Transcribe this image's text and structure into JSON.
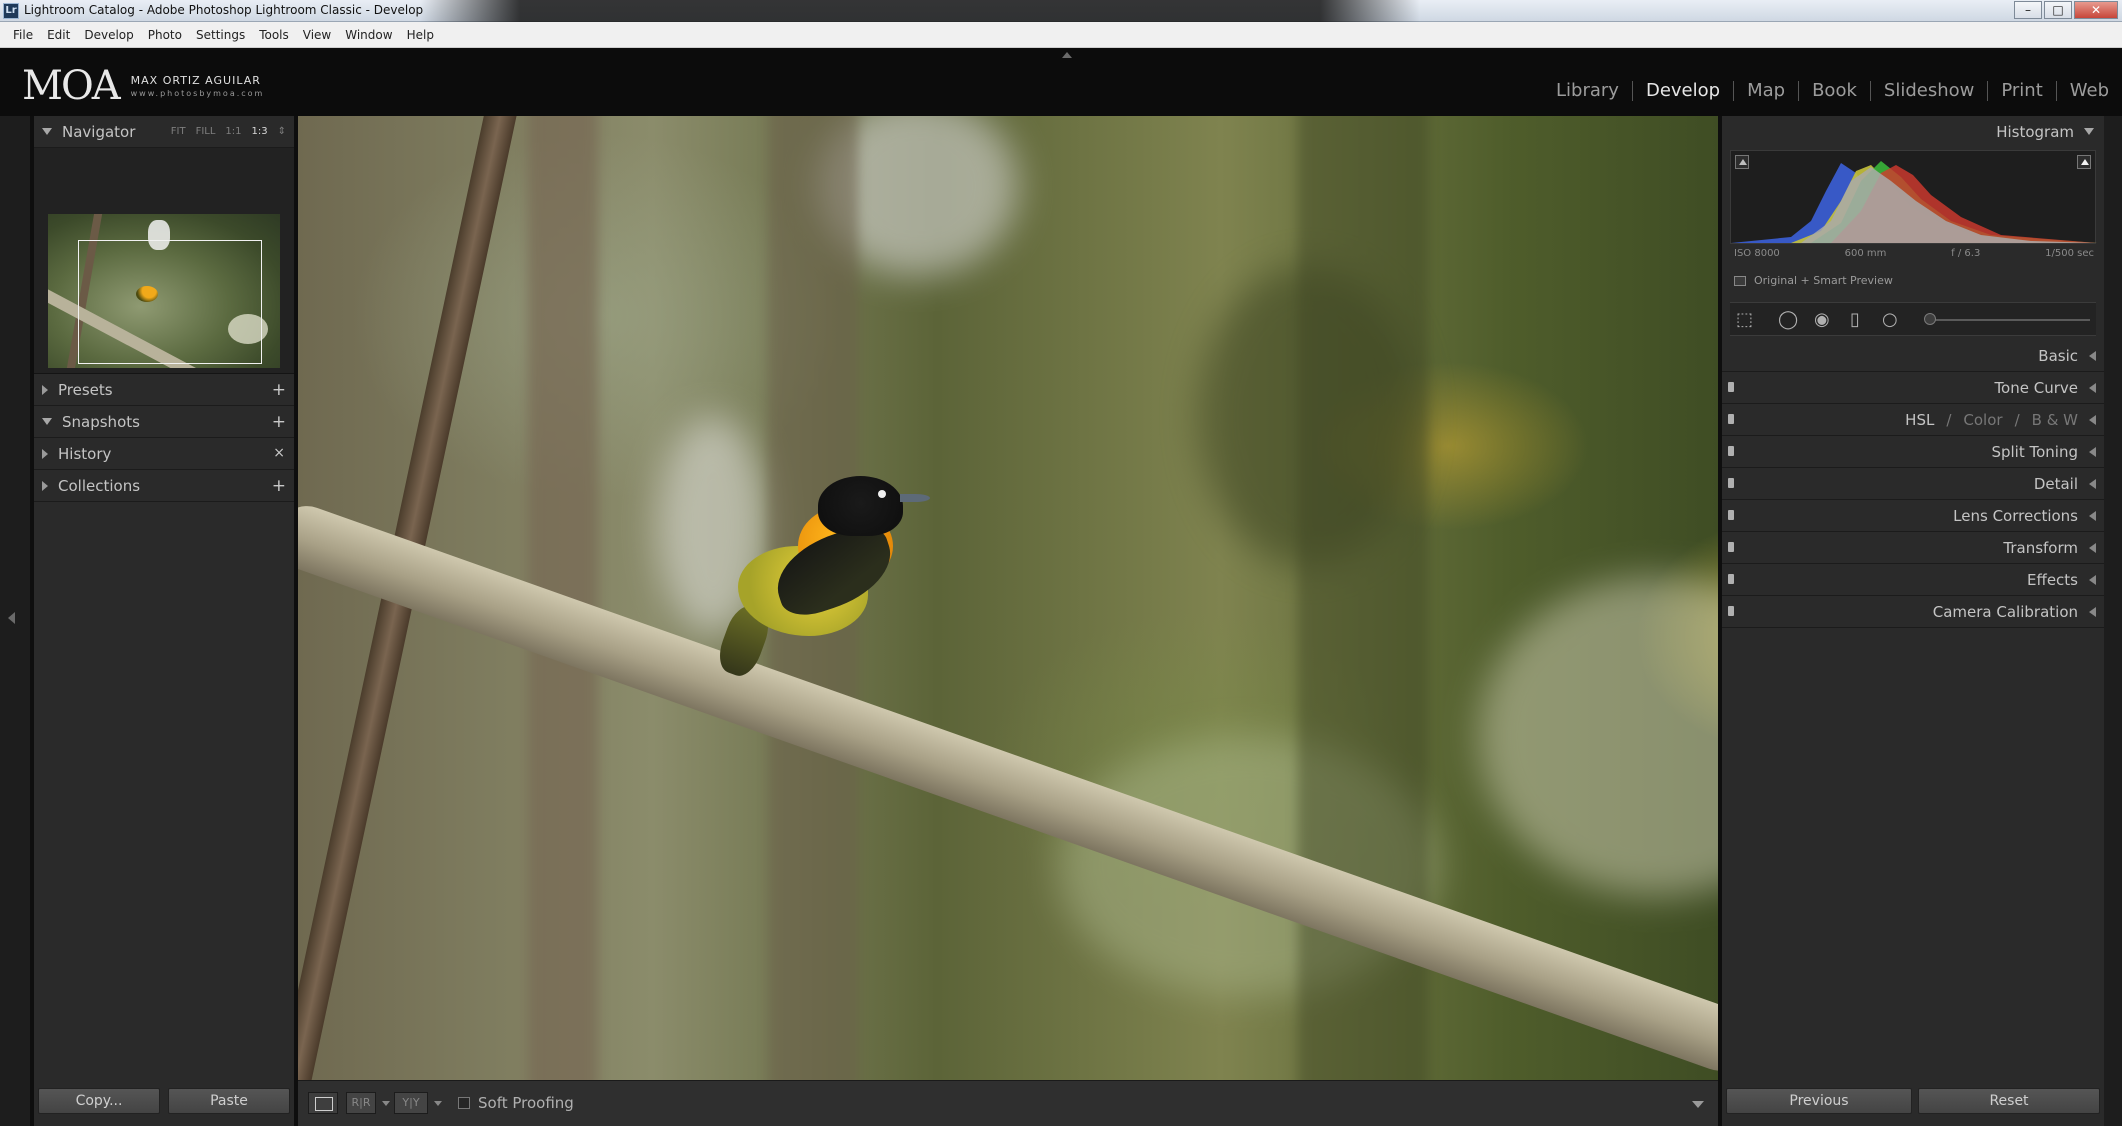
{
  "window": {
    "title": "Lightroom Catalog - Adobe Photoshop Lightroom Classic - Develop",
    "app_icon": "Lr",
    "controls": [
      "minimize",
      "maximize",
      "close"
    ]
  },
  "menu": [
    "File",
    "Edit",
    "Develop",
    "Photo",
    "Settings",
    "Tools",
    "View",
    "Window",
    "Help"
  ],
  "identity": {
    "mark": "MOA",
    "name": "MAX ORTIZ AGUILAR",
    "url": "www.photosbymoa.com"
  },
  "modules": {
    "items": [
      "Library",
      "Develop",
      "Map",
      "Book",
      "Slideshow",
      "Print",
      "Web"
    ],
    "active": "Develop"
  },
  "left_panel": {
    "navigator": {
      "title": "Navigator",
      "zoom": [
        "FIT",
        "FILL",
        "1:1",
        "1:3"
      ],
      "selected_zoom": "1:3"
    },
    "sections": [
      {
        "title": "Presets",
        "action": "+"
      },
      {
        "title": "Snapshots",
        "action": "+"
      },
      {
        "title": "History",
        "action": "×"
      },
      {
        "title": "Collections",
        "action": "+"
      }
    ],
    "buttons": {
      "copy": "Copy...",
      "paste": "Paste"
    }
  },
  "toolbar": {
    "view_ryr": "R|R",
    "view_yy": "Y|Y",
    "soft_proofing": "Soft Proofing"
  },
  "right_panel": {
    "histogram": {
      "title": "Histogram",
      "iso": "ISO 8000",
      "focal": "600 mm",
      "aperture": "f / 6.3",
      "shutter": "1/500 sec",
      "preview": "Original + Smart Preview"
    },
    "panels": [
      "Basic",
      "Tone Curve",
      "HSL",
      "Color",
      "B & W",
      "Split Toning",
      "Detail",
      "Lens Corrections",
      "Transform",
      "Effects",
      "Camera Calibration"
    ],
    "buttons": {
      "previous": "Previous",
      "reset": "Reset"
    }
  },
  "colors": {
    "panel": "#2a2a2a",
    "background": "#0c0c0c",
    "text": "#c4c4c4",
    "active_module": "#e6e6e6"
  }
}
